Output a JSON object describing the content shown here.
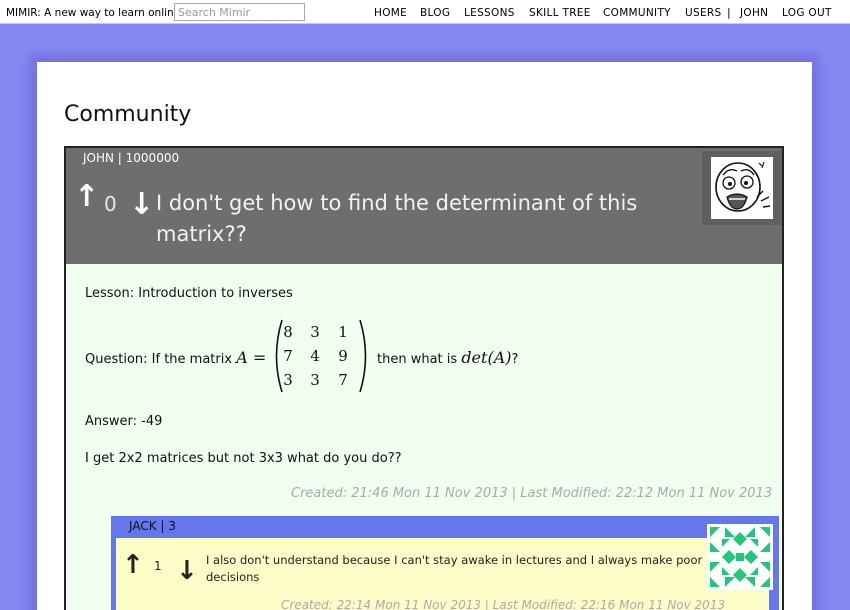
{
  "header": {
    "brand": "MIMIR: A new way to learn online",
    "search_placeholder": "Search Mimir",
    "nav": {
      "home": "HOME",
      "blog": "BLOG",
      "lessons": "LESSONS",
      "skill_tree": "SKILL TREE",
      "community": "COMMUNITY",
      "users": "USERS",
      "separator": "|",
      "user": "JOHN",
      "logout": "LOG OUT"
    }
  },
  "page": {
    "title": "Community"
  },
  "post": {
    "author": "JOHN | 1000000",
    "votes": "0",
    "title": "I don't get how to find the determinant of this matrix??",
    "lesson": "Lesson: Introduction to inverses",
    "question_prefix": "Question: If the matrix",
    "matrix_name": "A =",
    "matrix": [
      "8",
      "3",
      "1",
      "7",
      "4",
      "9",
      "3",
      "3",
      "7"
    ],
    "question_suffix": "then what is",
    "det_expr": "det(A)",
    "question_mark": "?",
    "answer": "Answer: -49",
    "body": "I get 2x2 matrices but not 3x3 what do you do??",
    "meta": "Created: 21:46 Mon 11 Nov 2013 | Last Modified: 22:12 Mon 11 Nov 2013",
    "avatar_icon": "rage-face-avatar-icon"
  },
  "reply": {
    "author": "JACK | 3",
    "votes": "1",
    "text": "I also don't understand because I can't stay awake in lectures and I always make poor decisions",
    "meta": "Created: 22:14 Mon 11 Nov 2013 | Last Modified: 22:16 Mon 11 Nov 2013",
    "avatar_icon": "green-identicon-avatar-icon",
    "colors": {
      "identicon": "#22c77a",
      "frame": "#6677ee"
    }
  },
  "colors": {
    "background": "#8888f2",
    "post_header": "#6e6e6e",
    "post_body": "#f0fff0",
    "reply_body": "#fdfdc8"
  }
}
